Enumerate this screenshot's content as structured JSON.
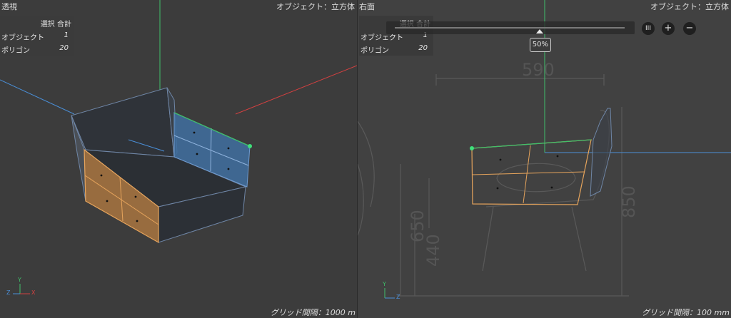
{
  "left_viewport": {
    "name": "透視",
    "object_label": "オブジェクト：立方体",
    "stats": {
      "header": "選択 合計",
      "rows": [
        {
          "label": "オブジェクト",
          "value": "1"
        },
        {
          "label": "ポリゴン",
          "value": "20"
        }
      ]
    },
    "grid_spacing": "グリッド間隔：1000 m"
  },
  "right_viewport": {
    "name": "右面",
    "object_label": "オブジェクト：立方体",
    "stats": {
      "header": "選択 合計",
      "rows": [
        {
          "label": "オブジェクト",
          "value": "1"
        },
        {
          "label": "ポリゴン",
          "value": "20"
        }
      ]
    },
    "zoom": {
      "value_label": "50%",
      "level": 0.63,
      "buttons": {
        "pause": "III",
        "plus": "+",
        "minus": "−"
      }
    },
    "blueprint_dimensions": [
      "590",
      "650",
      "440",
      "850"
    ],
    "grid_spacing": "グリッド間隔：100 mm"
  },
  "axis_labels": {
    "x": "X",
    "y": "Y",
    "z": "Z"
  },
  "colors": {
    "selected_polygon": "#e6a45c",
    "selected_fill_front": "#a8743f",
    "selected_fill_side": "#3f6fa0",
    "axis_x": "#d04040",
    "axis_y": "#3fbf6a",
    "axis_z": "#4a8fd8",
    "edge": "#6f86a6"
  }
}
